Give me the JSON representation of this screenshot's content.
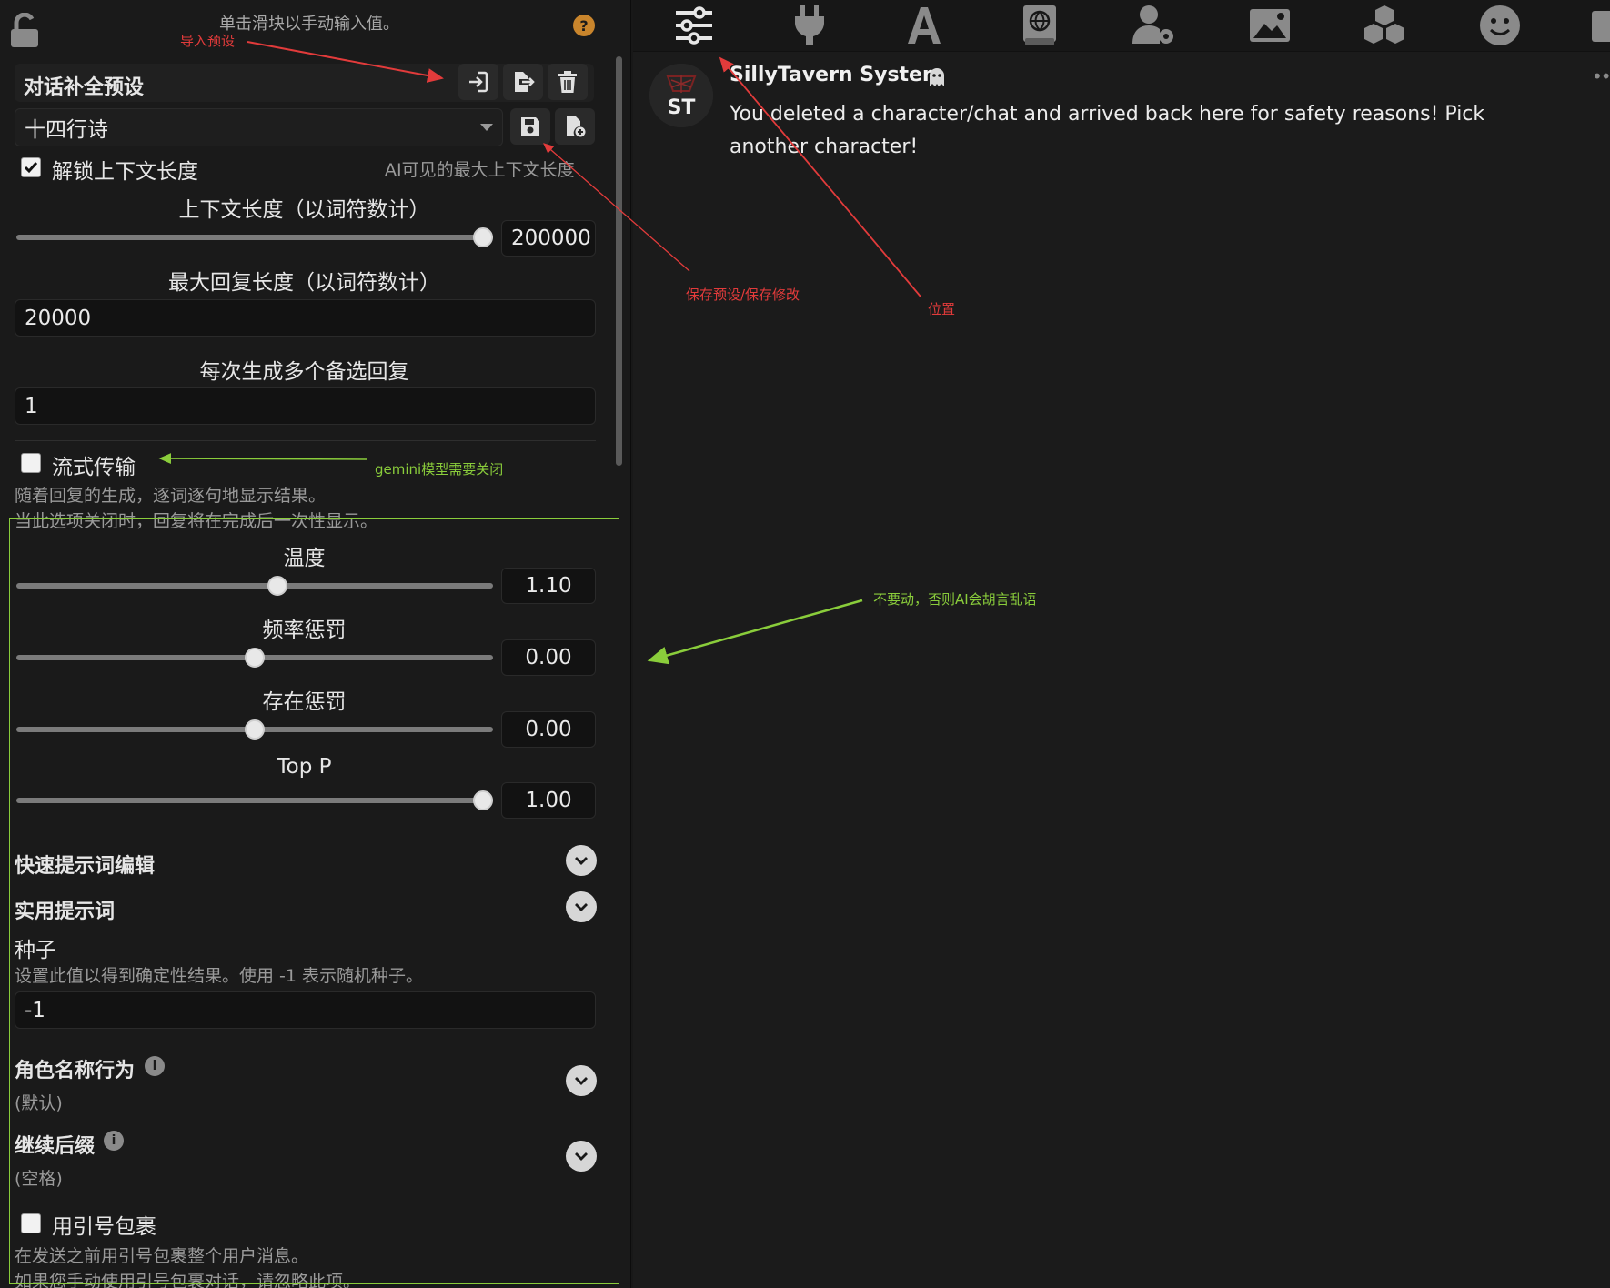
{
  "left": {
    "hint": "单击滑块以手动输入值。",
    "preset_section_title": "对话补全预设",
    "preset_select": {
      "value": "十四行诗"
    },
    "unlock_context_label": "解锁上下文长度",
    "unlock_context_checked": true,
    "unlock_context_note": "AI可见的最大上下文长度",
    "context_length": {
      "label": "上下文长度（以词符数计）",
      "value": "200000",
      "fraction": 1.0
    },
    "max_response": {
      "label": "最大回复长度（以词符数计）",
      "value": "20000"
    },
    "multi_swipe": {
      "label": "每次生成多个备选回复",
      "value": "1"
    },
    "streaming": {
      "label": "流式传输",
      "checked": false,
      "desc_line1": "随着回复的生成，逐词逐句地显示结果。",
      "desc_line2": "当此选项关闭时，回复将在完成后一次性显示。"
    },
    "sliders": [
      {
        "name": "temperature",
        "label": "温度",
        "value": "1.10",
        "fraction": 0.55
      },
      {
        "name": "frequency-penalty",
        "label": "频率惩罚",
        "value": "0.00",
        "fraction": 0.5
      },
      {
        "name": "presence-penalty",
        "label": "存在惩罚",
        "value": "0.00",
        "fraction": 0.5
      },
      {
        "name": "top-p",
        "label": "Top P",
        "value": "1.00",
        "fraction": 1.0
      }
    ],
    "quick_prompts_title": "快速提示词编辑",
    "utility_prompts_title": "实用提示词",
    "seed": {
      "label": "种子",
      "desc": "设置此值以得到确定性结果。使用 -1 表示随机种子。",
      "value": "-1"
    },
    "char_name_behavior": {
      "title": "角色名称行为",
      "value": "(默认)"
    },
    "continue_postfix": {
      "title": "继续后缀",
      "value": "(空格)"
    },
    "wrap_quotes": {
      "label": "用引号包裹",
      "checked": false,
      "desc_line1": "在发送之前用引号包裹整个用户消息。",
      "desc_line2": "如果您手动使用引号包裹对话，请忽略此项。"
    }
  },
  "chat": {
    "sender": "SillyTavern System",
    "avatar_text": "ST",
    "message": "You deleted a character/chat and arrived back here for safety reasons! Pick another character!"
  },
  "annotations": {
    "import_preset": "导入预设",
    "save_preset": "保存预设/保存修改",
    "position": "位置",
    "gemini_note": "gemini模型需要关闭",
    "dont_touch": "不要动，否则AI会胡言乱语"
  },
  "colors": {
    "annotation_red": "#e23b3b",
    "annotation_green": "#8acd3b",
    "help_badge": "#c9852c"
  },
  "icons": {
    "top_nav": [
      "sliders-icon",
      "plug-icon",
      "font-icon",
      "book-globe-icon",
      "user-gear-icon",
      "image-icon",
      "cubes-icon",
      "smile-icon",
      "id-card-icon"
    ],
    "preset_buttons": [
      "import-icon",
      "export-icon",
      "trash-icon"
    ],
    "select_buttons": [
      "save-icon",
      "new-file-icon"
    ]
  }
}
